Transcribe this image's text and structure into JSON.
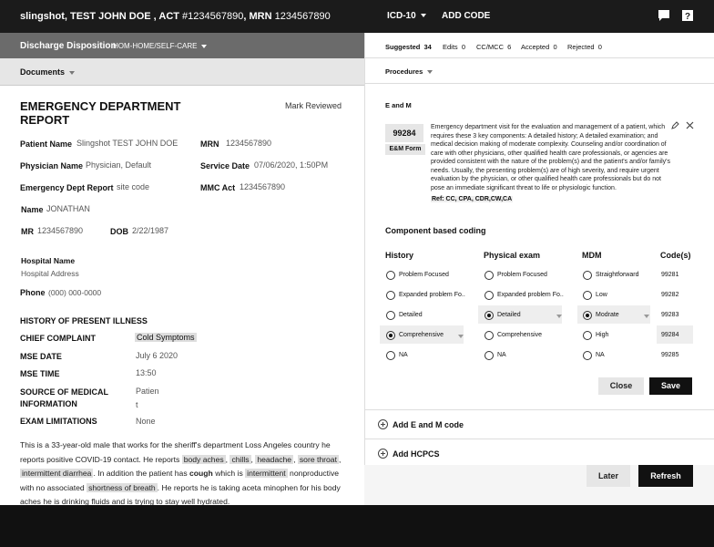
{
  "header": {
    "patient_bold": "slingshot, TEST JOHN DOE , ACT ",
    "act_number": "#1234567890",
    "mrn_label": ", MRN ",
    "mrn_value": "1234567890",
    "code_system": "ICD-10",
    "add_code": "ADD CODE",
    "icons": [
      "comment-icon",
      "help-icon"
    ]
  },
  "disposition": {
    "label": "Discharge Disposition",
    "value": "HOM-HOME/SELF-CARE"
  },
  "documents": {
    "label": "Documents"
  },
  "report": {
    "title_line1": "EMERGENCY DEPARTMENT",
    "title_line2": "REPORT",
    "mark_reviewed": "Mark Reviewed",
    "patient_name_label": "Patient Name",
    "patient_name_value": "Slingshot  TEST JOHN DOE",
    "mrn_label": "MRN",
    "mrn_value": "1234567890",
    "physician_label": "Physician Name",
    "physician_value": "Physician, Default",
    "service_date_label": "Service Date",
    "service_date_value": "07/06/2020, 1:50PM",
    "edr_label": "Emergency Dept Report",
    "edr_value": "site code",
    "mmc_label": "MMC Act",
    "mmc_value": "1234567890",
    "name_label": "Name",
    "name_value": "JONATHAN",
    "mr_label": "MR",
    "mr_value": "1234567890",
    "dob_label": "DOB",
    "dob_value": "2/22/1987",
    "hospital_name": "Hospital Name",
    "hospital_address": "Hospital Address",
    "phone_label": "Phone",
    "phone_value": "(000) 000-0000",
    "hpi_title": "HISTORY OF PRESENT ILLNESS",
    "cc_label": "CHIEF COMPLAINT",
    "cc_value": "Cold Symptoms",
    "mse_date_label": "MSE DATE",
    "mse_date_value": "July 6 2020",
    "mse_time_label": "MSE TIME",
    "mse_time_value": "13:50",
    "source_label_1": "SOURCE OF MEDICAL",
    "source_label_2": "INFORMATION",
    "source_value_1": "Patien",
    "source_value_2": "t",
    "exam_label": "EXAM LIMITATIONS",
    "exam_value": "None",
    "para": {
      "t1": "This is a 33-year-old male that works for the sheriff's department Loss Angeles country he reports positive COVID-19 contact. He reports ",
      "h1": "body aches",
      "t2": ", ",
      "h2": "chills",
      "t3": ", ",
      "h3": "headache",
      "t4": ", ",
      "h4": "sore throat",
      "t5": ", ",
      "h5": "intermittent diarrhea",
      "t6": ". In addition the patient has ",
      "bold1": "cough",
      "t7": " which is ",
      "h6": "intermittent",
      "t8": " nonproductive with no associated ",
      "h7": "shortness of breath",
      "t9": ". He reports he is taking aceta minophen for his body aches he is drinking fluids and is trying to stay well hydrated."
    }
  },
  "tabs": {
    "suggested_label": "Suggested",
    "suggested_count": "34",
    "edits_label": "Edits",
    "edits_count": "0",
    "ccmcc_label": "CC/MCC",
    "ccmcc_count": "6",
    "accepted_label": "Accepted",
    "accepted_count": "0",
    "rejected_label": "Rejected",
    "rejected_count": "0"
  },
  "procedures": {
    "label": "Procedures"
  },
  "em": {
    "title": "E and M",
    "code": "99284",
    "form_tag": "E&M Form",
    "description": "Emergency department visit for the evaluation and management of a patient, which requires these 3 key components: A detailed history; A detailed examination; and medical decision making of moderate complexity. Counseling and/or coordination of care with other physicians, other qualified health care professionals, or agencies are provided consistent with the nature of the problem(s) and the patient's and/or family's needs. Usually, the presenting problem(s) are of high severity, and require urgent evaluation by the physician, or other qualified health care professionals but do not pose an immediate significant threat to life or physiologic function.",
    "ref": "Ref: CC, CPA, CDR,CW,CA",
    "component_title": "Component based coding",
    "col_history": "History",
    "col_exam": "Physical exam",
    "col_mdm": "MDM",
    "col_codes": "Code(s)",
    "history": [
      "Problem Focused",
      "Expanded problem Fo..",
      "Detailed",
      "Comprehensive",
      "NA"
    ],
    "exam": [
      "Problem Focused",
      "Expanded problem Fo..",
      "Detailed",
      "Comprehensive",
      "NA"
    ],
    "mdm": [
      "Straightforward",
      "Low",
      "Modrate",
      "High",
      "NA"
    ],
    "codes": [
      "99281",
      "99282",
      "99283",
      "99284",
      "99285"
    ],
    "close": "Close",
    "save": "Save",
    "add_em": "Add E and M code",
    "add_hcpcs": "Add HCPCS"
  },
  "bottom": {
    "later": "Later",
    "refresh": "Refresh"
  }
}
